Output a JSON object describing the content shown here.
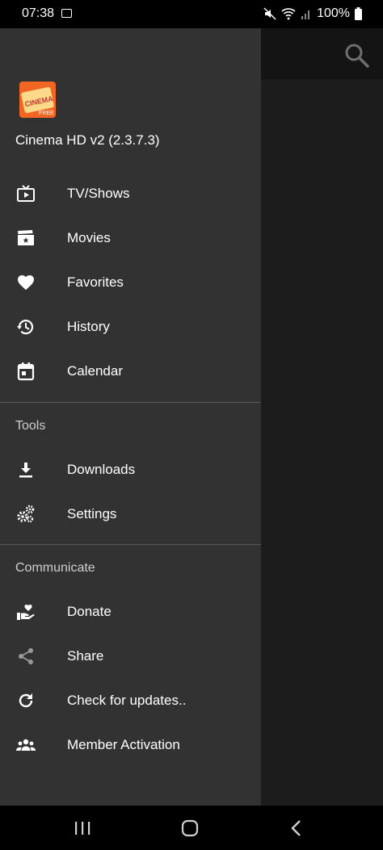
{
  "status_bar": {
    "time": "07:38",
    "battery": "100%"
  },
  "app": {
    "title": "Cinema HD v2 (2.3.7.3)",
    "logo_text": "CINEMA",
    "logo_sub": "FREE"
  },
  "menu": [
    {
      "label": "TV/Shows",
      "icon": "tv-icon"
    },
    {
      "label": "Movies",
      "icon": "movie-icon"
    },
    {
      "label": "Favorites",
      "icon": "heart-icon"
    },
    {
      "label": "History",
      "icon": "history-icon"
    },
    {
      "label": "Calendar",
      "icon": "calendar-icon"
    }
  ],
  "tools": {
    "header": "Tools",
    "items": [
      {
        "label": "Downloads",
        "icon": "download-icon"
      },
      {
        "label": "Settings",
        "icon": "settings-icon"
      }
    ]
  },
  "communicate": {
    "header": "Communicate",
    "items": [
      {
        "label": "Donate",
        "icon": "donate-icon"
      },
      {
        "label": "Share",
        "icon": "share-icon"
      },
      {
        "label": "Check for updates..",
        "icon": "refresh-icon"
      },
      {
        "label": "Member Activation",
        "icon": "group-icon"
      }
    ]
  }
}
